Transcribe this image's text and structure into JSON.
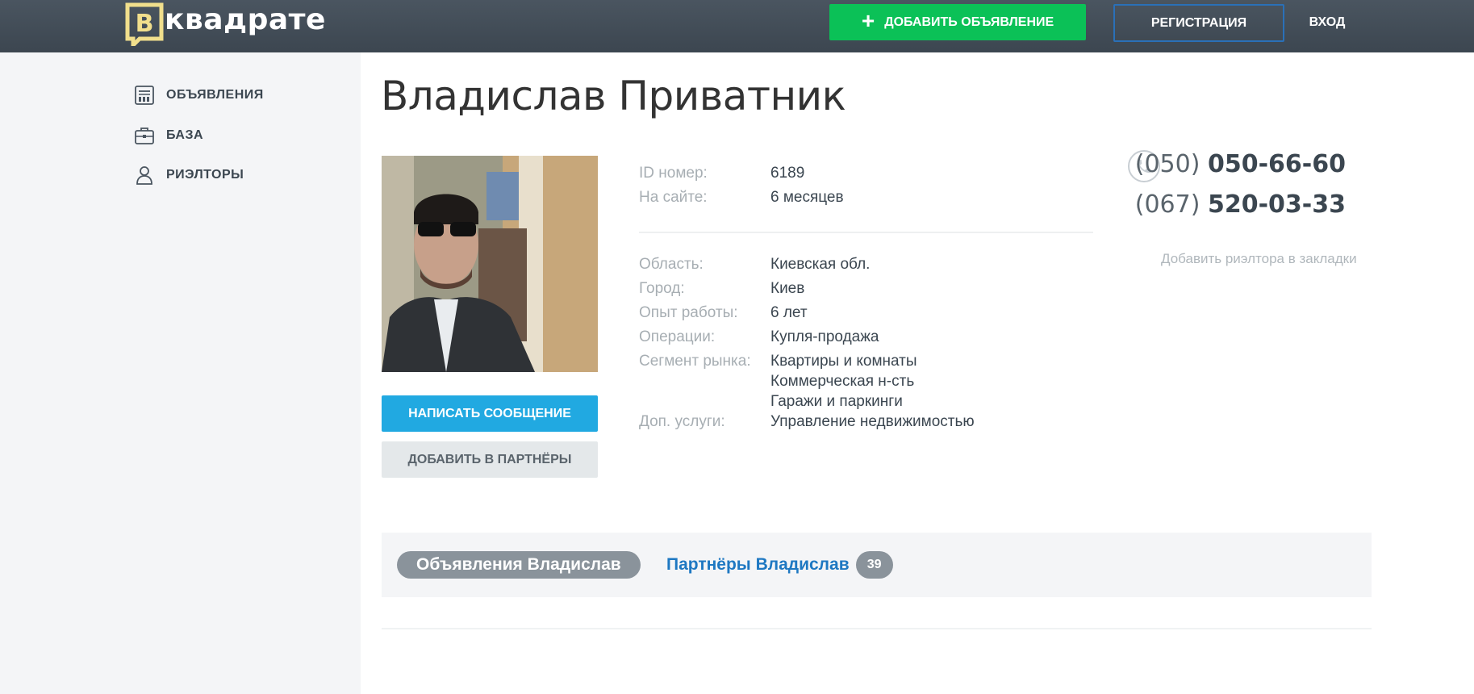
{
  "header": {
    "logo_text": "квадрате",
    "add_listing_label": "ДОБАВИТЬ ОБЪЯВЛЕНИЕ",
    "register_label": "РЕГИСТРАЦИЯ",
    "login_label": "ВХОД"
  },
  "sidebar": {
    "items": [
      {
        "label": "ОБЪЯВЛЕНИЯ",
        "icon": "listings-icon"
      },
      {
        "label": "БАЗА",
        "icon": "briefcase-icon"
      },
      {
        "label": "РИЭЛТОРЫ",
        "icon": "person-icon"
      }
    ]
  },
  "profile": {
    "name": "Владислав Приватник",
    "send_message_label": "НАПИСАТЬ СООБЩЕНИЕ",
    "add_partner_label": "ДОБАВИТЬ В ПАРТНЁРЫ",
    "info_top": [
      {
        "key": "ID номер:",
        "value": "6189"
      },
      {
        "key": "На сайте:",
        "value": "6 месяцев"
      }
    ],
    "info": [
      {
        "key": "Область:",
        "value": "Киевская обл."
      },
      {
        "key": "Город:",
        "value": "Киев"
      },
      {
        "key": "Опыт работы:",
        "value": "6 лет"
      },
      {
        "key": "Операции:",
        "value": "Купля-продажа"
      },
      {
        "key": "Сегмент рынка:",
        "value": "Квартиры и комнаты"
      },
      {
        "key": "",
        "value": "Коммерческая н-сть"
      },
      {
        "key": "",
        "value": "Гаражи и паркинги"
      },
      {
        "key": "Доп. услуги:",
        "value": "Управление недвижимостью"
      }
    ],
    "phones": [
      {
        "code": "(050)",
        "number": "050-66-60"
      },
      {
        "code": "(067)",
        "number": "520-03-33"
      }
    ],
    "bookmark_label": "Добавить риэлтора в закладки"
  },
  "tabs": {
    "active_label": "Объявления Владислав",
    "partners_label": "Партнёры Владислав",
    "partners_count": "39"
  },
  "colors": {
    "header_bg": "#424d57",
    "accent_green": "#0bc157",
    "accent_blue": "#21a9e1",
    "link_blue": "#1e78c2"
  }
}
